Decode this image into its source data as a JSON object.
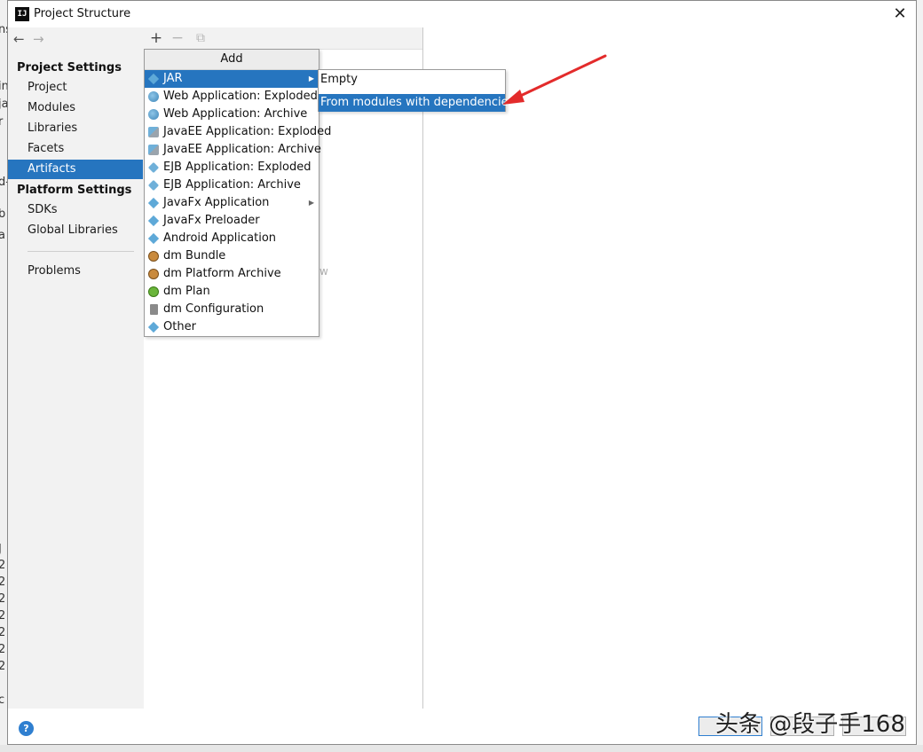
{
  "window": {
    "title": "Project Structure",
    "app_icon_text": "IJ"
  },
  "nav": {
    "back_glyph": "←",
    "forward_glyph": "→",
    "project_settings_header": "Project Settings",
    "project_settings_items": [
      "Project",
      "Modules",
      "Libraries",
      "Facets",
      "Artifacts"
    ],
    "selected_item": "Artifacts",
    "platform_settings_header": "Platform Settings",
    "platform_settings_items": [
      "SDKs",
      "Global Libraries"
    ],
    "problems_label": "Problems"
  },
  "toolbar": {
    "add_glyph": "+",
    "remove_glyph": "−",
    "copy_glyph": "⧉"
  },
  "ghost_text": "w",
  "add_menu": {
    "title": "Add",
    "items": [
      {
        "label": "JAR",
        "icon": "artifact-diamond-icon",
        "has_submenu": true,
        "selected": true
      },
      {
        "label": "Web Application: Exploded",
        "icon": "web-globe-icon"
      },
      {
        "label": "Web Application: Archive",
        "icon": "web-globe-icon"
      },
      {
        "label": "JavaEE Application: Exploded",
        "icon": "javaee-icon"
      },
      {
        "label": "JavaEE Application: Archive",
        "icon": "javaee-icon"
      },
      {
        "label": "EJB Application: Exploded",
        "icon": "ejb-icon"
      },
      {
        "label": "EJB Application: Archive",
        "icon": "ejb-icon"
      },
      {
        "label": "JavaFx Application",
        "icon": "artifact-diamond-icon",
        "has_submenu": true
      },
      {
        "label": "JavaFx Preloader",
        "icon": "artifact-diamond-icon"
      },
      {
        "label": "Android Application",
        "icon": "artifact-diamond-icon"
      },
      {
        "label": "dm Bundle",
        "icon": "dm-bundle-icon"
      },
      {
        "label": "dm Platform Archive",
        "icon": "dm-bundle-icon"
      },
      {
        "label": "dm Plan",
        "icon": "dm-plan-icon"
      },
      {
        "label": "dm Configuration",
        "icon": "dm-config-icon"
      },
      {
        "label": "Other",
        "icon": "artifact-diamond-icon"
      }
    ]
  },
  "jar_submenu": {
    "items": [
      {
        "label": "Empty",
        "selected": false
      },
      {
        "label": "From modules with dependencies...",
        "selected": true
      }
    ]
  },
  "bottom": {
    "help_glyph": "?"
  },
  "watermark": "头条 @段子手168",
  "background_ide_lines": [
    "ns",
    "in",
    "ja",
    "r",
    "d-",
    "b",
    "a",
    "J",
    "2",
    "2",
    "2",
    "2",
    "2",
    "2",
    "2",
    "c"
  ],
  "colors": {
    "selection": "#2675bf",
    "annotation_arrow": "#e32b2b",
    "help_blue": "#2f7fd0"
  }
}
